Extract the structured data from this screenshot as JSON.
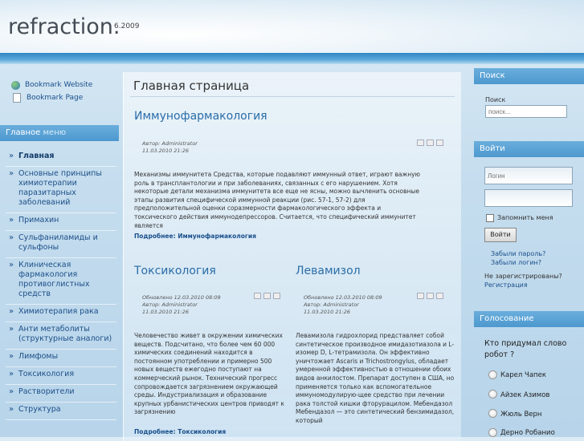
{
  "header": {
    "logo": "refraction.",
    "version": "6.2009"
  },
  "bookmarks": [
    {
      "label": "Bookmark Website",
      "icon": "globe-icon"
    },
    {
      "label": "Bookmark Page",
      "icon": "page-icon"
    }
  ],
  "main_menu": {
    "title_bold": "Главное",
    "title_rest": "меню",
    "items": [
      {
        "label": "Главная",
        "active": true
      },
      {
        "label": "Основные принципы химиотерапии паразитарных заболеваний"
      },
      {
        "label": "Примахин"
      },
      {
        "label": "Сульфаниламиды и сульфоны"
      },
      {
        "label": "Клиническая фармакология противоглистных средств"
      },
      {
        "label": "Химиотерапия рака"
      },
      {
        "label": "Анти метаболиты (структурные аналоги)"
      },
      {
        "label": "Лимфомы"
      },
      {
        "label": "Токсикология"
      },
      {
        "label": "Растворители"
      },
      {
        "label": "Структура"
      }
    ]
  },
  "content": {
    "page_title": "Главная страница",
    "articles": [
      {
        "title": "Иммунофармакология",
        "updated": "",
        "author": "Автор: Administrator",
        "date": "11.03.2010 21:26",
        "text": "Механизмы иммунитета Средства, которые подавляют иммунный ответ, играют важную роль в трансплантологии и при заболеваниях, связанных с его нарушением. Хотя некоторые детали механизма иммунитета все еще не ясны, можно вычленить основные этапы развития специфической иммунной реакции (рис. 57-1, 57-2) для предположительной оценки соразмерности фармакологического эффекта и токсического действия иммунодепрессоров. Считается, что специфический иммунитет является",
        "more": "Подробнее: Иммунофармакология"
      },
      {
        "title": "Токсикология",
        "updated": "Обновлено 12.03.2010 08:09",
        "author": "Автор: Administrator",
        "date": "11.03.2010 21:26",
        "text": "Человечество живет в окружении химических веществ. Подсчитано, что более чем 60 000 химических соединений находится в постоянном употреблении и примерно 500 новых веществ ежегодно поступают на коммерческий рынок. Технический прогресс сопровождается загрязнением окружающей среды. Индустриализация и образование крупных урбанистических центров приводят к загрязнению",
        "more": "Подробнее: Токсикология"
      },
      {
        "title": "Левамизол",
        "updated": "Обновлено 12.03.2010 08:09",
        "author": "Автор: Administrator",
        "date": "11.03.2010 21:26",
        "text": "Левамизола гидрохлорид представляет собой синтетическое производное имидазотиазола и L-изомер D, L-тетрамизола. Он эффективно уничтожает Ascaris и Trichostrongylus, обладает умеренной эффективностью в отношении обоих видов анкилостом. Препарат доступен в США, но применяется только как вспомогательное иммуномодулирую-щее средство при лечении рака толстой кишки фторурацилом. Мебендазол Мебендазол — это синтетический бензимидазол, который",
        "more": ""
      }
    ]
  },
  "search": {
    "title": "Поиск",
    "label": "Поиск",
    "placeholder": "поиск..."
  },
  "login": {
    "title": "Войти",
    "login_placeholder": "Логин",
    "remember": "Запомнить меня",
    "button": "Войти",
    "forgot_password": "Забыли пароль?",
    "forgot_login": "Забыли логин?",
    "not_registered": "Не зарегистрированы?",
    "register": "Регистрация"
  },
  "poll": {
    "title": "Голосование",
    "question": "Кто придумал слово робот ?",
    "options": [
      "Карел Чапек",
      "Айзек Азимов",
      "Жюль Верн",
      "Дерно Робанио"
    ]
  },
  "colors": {
    "accent": "#4d98cf",
    "link": "#1a4f8b",
    "title_blue": "#2a6da8"
  }
}
